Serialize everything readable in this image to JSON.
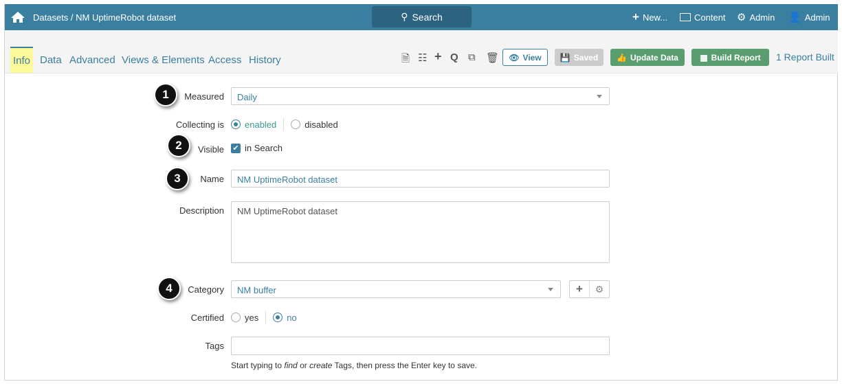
{
  "header": {
    "breadcrumb": "Datasets / NM UptimeRobot dataset",
    "search": "Search",
    "new": "New...",
    "content": "Content",
    "admin_settings": "Admin",
    "admin_user": "Admin"
  },
  "tabs": [
    {
      "label": "Info"
    },
    {
      "label": "Data"
    },
    {
      "label": "Advanced"
    },
    {
      "label": "Views & Elements"
    },
    {
      "label": "Access"
    },
    {
      "label": "History"
    }
  ],
  "toolbar": {
    "view": "View",
    "saved": "Saved",
    "update": "Update Data",
    "build": "Build Report",
    "reports": "1 Report Built"
  },
  "form": {
    "measured_label": "Measured",
    "measured_value": "Daily",
    "collecting_label": "Collecting is",
    "enabled": "enabled",
    "disabled": "disabled",
    "visible_label": "Visible",
    "in_search": "in Search",
    "name_label": "Name",
    "name_value": "NM UptimeRobot dataset",
    "description_label": "Description",
    "description_value": "NM UptimeRobot dataset",
    "category_label": "Category",
    "category_value": "NM buffer",
    "certified_label": "Certified",
    "yes": "yes",
    "no": "no",
    "tags_label": "Tags",
    "tags_value": "",
    "help_1": "Start typing to ",
    "help_find": "find",
    "help_2": " or ",
    "help_create": "create",
    "help_3": " Tags, then press the Enter key to save."
  },
  "badges": [
    "1",
    "2",
    "3",
    "4"
  ],
  "colors": {
    "header": "#3a7fa0",
    "green": "#5a9e6f",
    "active_tab": "#fbf99a"
  }
}
